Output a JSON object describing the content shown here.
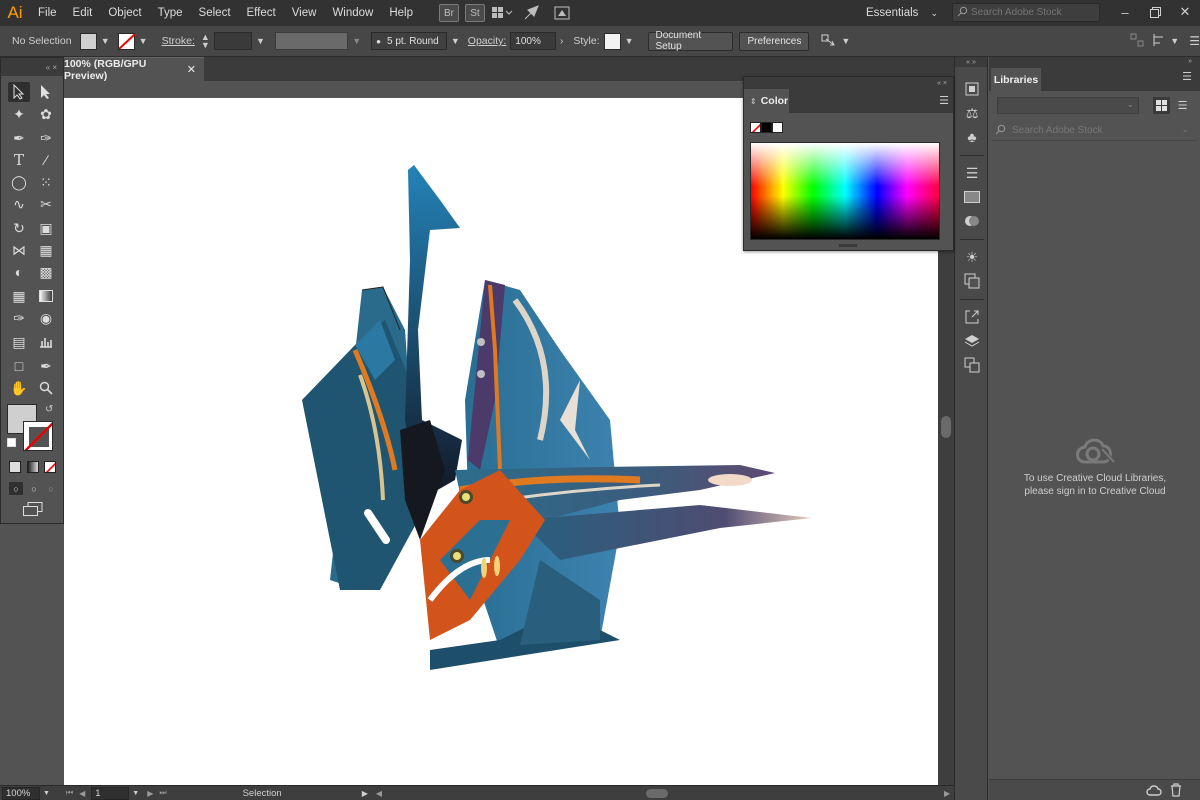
{
  "app": {
    "logo": "Ai"
  },
  "menu": [
    "File",
    "Edit",
    "Object",
    "Type",
    "Select",
    "Effect",
    "View",
    "Window",
    "Help"
  ],
  "menubar_buttons": {
    "bridge": "Br",
    "stock": "St"
  },
  "workspace": {
    "label": "Essentials"
  },
  "stock_search": {
    "placeholder": "Search Adobe Stock"
  },
  "control_bar": {
    "selection": "No Selection",
    "stroke_label": "Stroke:",
    "brush": "5 pt. Round",
    "opacity_label": "Opacity:",
    "opacity_value": "100%",
    "style_label": "Style:",
    "document_setup": "Document Setup",
    "preferences": "Preferences"
  },
  "document": {
    "tab_title": "100% (RGB/GPU Preview)"
  },
  "status_bar": {
    "zoom": "100%",
    "artboard": "1",
    "tool": "Selection"
  },
  "color_panel": {
    "title": "Color"
  },
  "libraries": {
    "title": "Libraries",
    "search_placeholder": "Search Adobe Stock",
    "message_line1": "To use Creative Cloud Libraries,",
    "message_line2": "please sign in to Creative Cloud"
  }
}
